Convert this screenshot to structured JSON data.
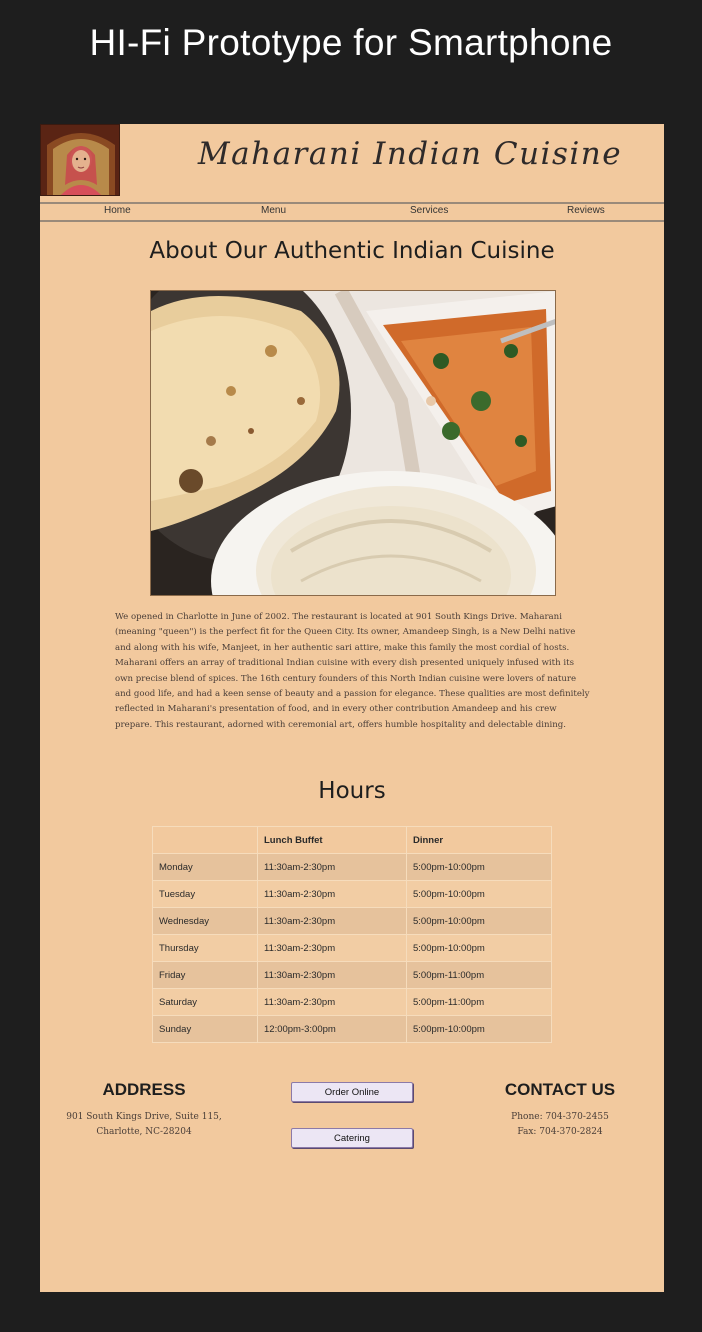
{
  "frame": {
    "title": "HI-Fi Prototype for Smartphone"
  },
  "brand": {
    "name": "Maharani Indian Cuisine"
  },
  "nav": {
    "items": [
      "Home",
      "Menu",
      "Services",
      "Reviews"
    ]
  },
  "about": {
    "title": "About Our Authentic Indian Cuisine",
    "text": "We opened in Charlotte in June of 2002. The restaurant is located at 901 South Kings Drive. Maharani (meaning \"queen\") is the perfect fit for the Queen City. Its owner, Amandeep Singh, is a New Delhi native and along with his wife, Manjeet, in her authentic sari attire, make this family the most cordial of hosts. Maharani offers an array of traditional Indian cuisine with every dish presented uniquely infused with its own precise blend of spices. The 16th century founders of this North Indian cuisine were lovers of nature and good life, and had a keen sense of beauty and a passion for elegance. These qualities are most definitely reflected in Maharani's presentation of food, and in every other contribution Amandeep and his crew prepare. This restaurant, adorned with ceremonial art, offers humble hospitality and delectable dining."
  },
  "hours": {
    "title": "Hours",
    "headers": [
      "",
      "Lunch Buffet",
      "Dinner"
    ],
    "rows": [
      [
        "Monday",
        "11:30am-2:30pm",
        "5:00pm-10:00pm"
      ],
      [
        "Tuesday",
        "11:30am-2:30pm",
        "5:00pm-10:00pm"
      ],
      [
        "Wednesday",
        "11:30am-2:30pm",
        "5:00pm-10:00pm"
      ],
      [
        "Thursday",
        "11:30am-2:30pm",
        "5:00pm-10:00pm"
      ],
      [
        "Friday",
        "11:30am-2:30pm",
        "5:00pm-11:00pm"
      ],
      [
        "Saturday",
        "11:30am-2:30pm",
        "5:00pm-11:00pm"
      ],
      [
        "Sunday",
        "12:00pm-3:00pm",
        "5:00pm-10:00pm"
      ]
    ]
  },
  "address": {
    "title": "ADDRESS",
    "line1": "901 South Kings Drive, Suite 115,",
    "line2": "Charlotte, NC-28204"
  },
  "contact": {
    "title": "CONTACT US",
    "phone": "Phone: 704-370-2455",
    "fax": "Fax: 704-370-2824"
  },
  "buttons": {
    "order": "Order Online",
    "catering": "Catering"
  },
  "colors": {
    "page_bg": "#f2c99e",
    "frame_bg": "#1e1e1e",
    "button_bg": "#ece6f4",
    "button_border": "#8c7aa8"
  }
}
